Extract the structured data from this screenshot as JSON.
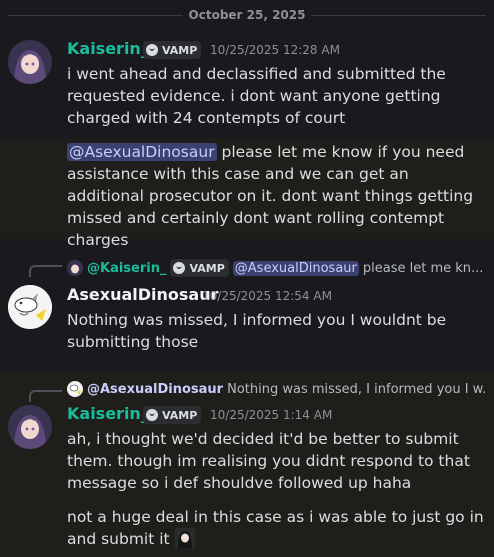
{
  "date_divider": "October 25, 2025",
  "messages": [
    {
      "author": "Kaiserin_",
      "tag": "VAMP",
      "timestamp": "10/25/2025 12:28 AM",
      "lines": [
        "i went ahead and declassified and submitted the requested evidence. i dont want anyone getting charged with 24 contempts of court"
      ]
    },
    {
      "mention": "@AsexualDinosaur",
      "text": " please let me know if you need assistance with this case and we can get an additional prosecutor on it. dont want things getting missed and certainly dont want rolling contempt charges"
    },
    {
      "reply": {
        "author": "@Kaiserin_",
        "tag": "VAMP",
        "mention": "@AsexualDinosaur",
        "preview": "please let me kn..."
      },
      "author": "AsexualDinosaur",
      "timestamp": "10/25/2025 12:54 AM",
      "text": "Nothing was missed, I informed you I wouldnt be submitting those"
    },
    {
      "reply": {
        "author": "@AsexualDinosaur",
        "preview": "Nothing was missed, I informed you I w..."
      },
      "author": "Kaiserin_",
      "tag": "VAMP",
      "timestamp": "10/25/2025 1:14 AM",
      "text": "ah, i thought we'd decided it'd be better to submit them. though im realising you didnt respond to that message so i def shouldve followed up haha"
    },
    {
      "text": "not a huge deal in this case as i was able to just go in and submit it"
    }
  ],
  "colors": {
    "background": "#1a1a1e",
    "highlight": "#1f1e1b",
    "kaiserin_name": "#1abc9c",
    "mention_bg": "#3c4270",
    "mention_fg": "#c9cdfb"
  },
  "icons": [
    "vamp-clan-icon",
    "avatar-kaiserin",
    "avatar-asexualdinosaur",
    "emoji-anime-girl"
  ]
}
